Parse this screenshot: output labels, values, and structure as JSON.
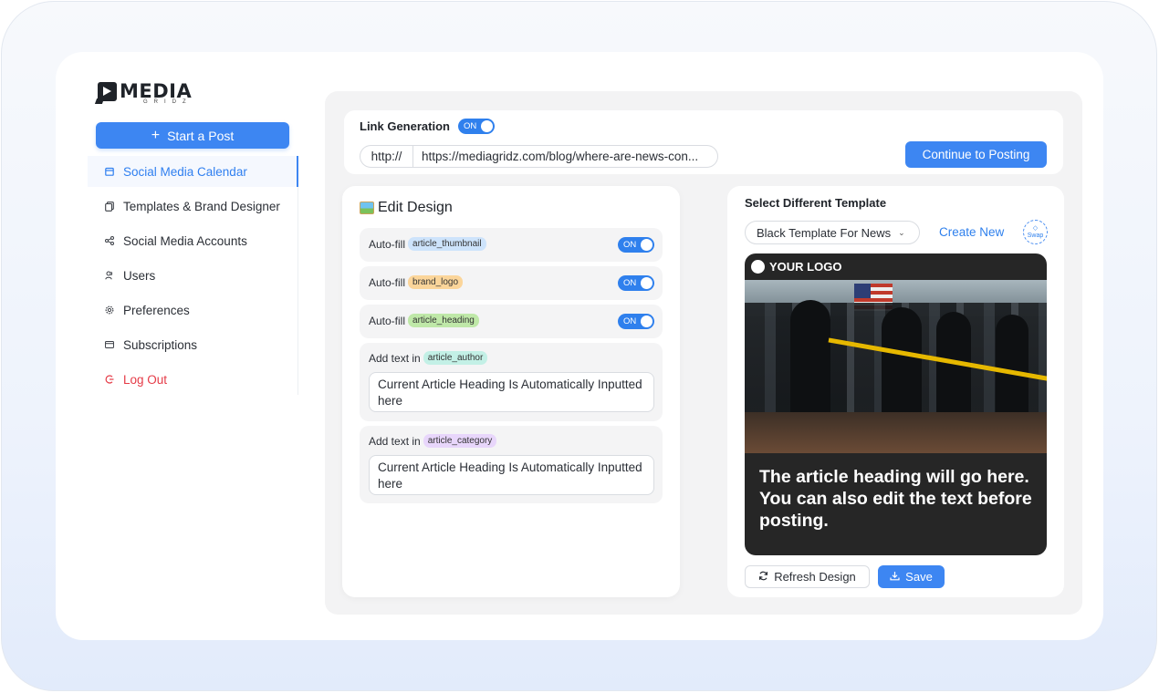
{
  "app": {
    "logo_word": "MEDIA",
    "logo_sub": "GRIDZ"
  },
  "sidebar": {
    "start_post": "Start a Post",
    "items": [
      {
        "label": "Social Media Calendar",
        "icon": "calendar-icon",
        "active": true
      },
      {
        "label": "Templates & Brand Designer",
        "icon": "templates-icon"
      },
      {
        "label": "Social Media Accounts",
        "icon": "share-icon"
      },
      {
        "label": "Users",
        "icon": "users-icon"
      },
      {
        "label": "Preferences",
        "icon": "gear-icon"
      },
      {
        "label": "Subscriptions",
        "icon": "card-icon"
      },
      {
        "label": "Log Out",
        "icon": "logout-icon"
      }
    ]
  },
  "link_generation": {
    "title": "Link Generation",
    "toggle": "ON",
    "url_prefix": "http://",
    "url_value": "https://mediagridz.com/blog/where-are-news-con...",
    "continue_label": "Continue to Posting"
  },
  "edit_design": {
    "title": "Edit Design",
    "autofill_label": "Auto-fill",
    "autofill_rows": [
      {
        "tag": "article_thumbnail",
        "toggle": "ON"
      },
      {
        "tag": "brand_logo",
        "toggle": "ON"
      },
      {
        "tag": "article_heading",
        "toggle": "ON"
      }
    ],
    "addtext_label": "Add text in",
    "addtext_rows": [
      {
        "tag": "article_author",
        "value": "Current Article Heading Is Automatically Inputted here"
      },
      {
        "tag": "article_category",
        "value": "Current Article Heading Is Automatically Inputted here"
      }
    ]
  },
  "preview": {
    "title": "Select Different Template",
    "template_selected": "Black Template For News",
    "create_new": "Create New",
    "swap_label": "Swap",
    "your_logo": "YOUR LOGO",
    "post_text": "The article heading will go here. You can also edit the text before posting.",
    "refresh_label": "Refresh Design",
    "save_label": "Save"
  },
  "colors": {
    "accent": "#3d86f2",
    "danger": "#e53b47",
    "preview_bg": "#262626"
  }
}
